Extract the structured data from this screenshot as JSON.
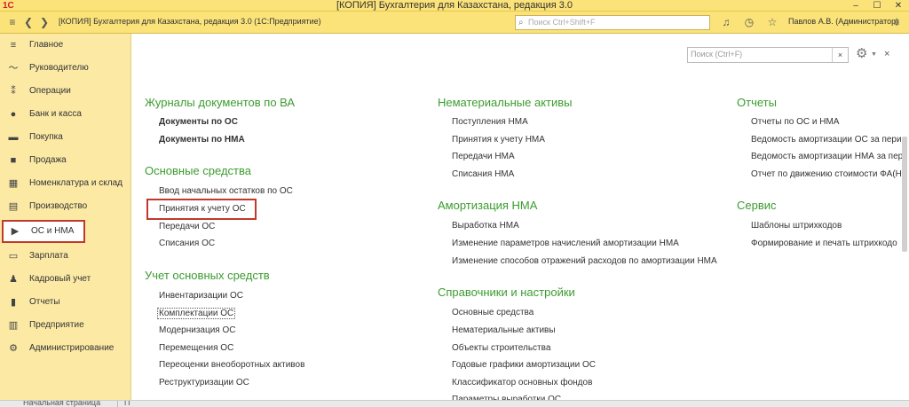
{
  "window": {
    "logo": "1С",
    "title": "[КОПИЯ] Бухгалтерия для Казахстана, редакция 3.0",
    "controls": [
      "–",
      "☐",
      "✕"
    ]
  },
  "toolbar": {
    "app_title": "[КОПИЯ] Бухгалтерия для Казахстана, редакция 3.0  (1С:Предприятие)",
    "search_placeholder": "Поиск Ctrl+Shift+F",
    "user": "Павлов А.В. (Администратор)"
  },
  "sidebar": {
    "items": [
      {
        "label": "Главное",
        "icon": "≡"
      },
      {
        "label": "Руководителю",
        "icon": "〜"
      },
      {
        "label": "Операции",
        "icon": "⁑"
      },
      {
        "label": "Банк и касса",
        "icon": "●"
      },
      {
        "label": "Покупка",
        "icon": "▬"
      },
      {
        "label": "Продажа",
        "icon": "■"
      },
      {
        "label": "Номенклатура и склад",
        "icon": "▦"
      },
      {
        "label": "Производство",
        "icon": "▤"
      },
      {
        "label": "ОС и НМА",
        "icon": "▶"
      },
      {
        "label": "Зарплата",
        "icon": "▭"
      },
      {
        "label": "Кадровый учет",
        "icon": "♟"
      },
      {
        "label": "Отчеты",
        "icon": "▮"
      },
      {
        "label": "Предприятие",
        "icon": "▥"
      },
      {
        "label": "Администрирование",
        "icon": "⚙"
      }
    ]
  },
  "bottombar": {
    "home": "Начальная страница",
    "next": "П"
  },
  "content": {
    "search_placeholder": "Поиск (Ctrl+F)",
    "clear": "×",
    "close": "×",
    "col1": {
      "sec1": "Журналы документов по ВА",
      "sec1_items": [
        "Документы по ОС",
        "Документы по НМА"
      ],
      "sec2": "Основные средства",
      "sec2_items": [
        "Ввод начальных остатков по ОС",
        "Принятия к учету ОС",
        "Передачи ОС",
        "Списания ОС"
      ],
      "sec3": "Учет основных средств",
      "sec3_items": [
        "Инвентаризации ОС",
        "Комплектации ОС",
        "Модернизация ОС",
        "Перемещения ОС",
        "Переоценки внеоборотных активов",
        "Реструктуризации ОС"
      ]
    },
    "col2": {
      "sec1": "Нематериальные активы",
      "sec1_items": [
        "Поступления НМА",
        "Принятия к учету НМА",
        "Передачи НМА",
        "Списания НМА"
      ],
      "sec2": "Амортизация НМА",
      "sec2_items": [
        "Выработка НМА",
        "Изменение параметров начислений амортизации НМА",
        "Изменение способов отражений расходов по амортизации НМА"
      ],
      "sec3": "Справочники и настройки",
      "sec3_items": [
        "Основные средства",
        "Нематериальные активы",
        "Объекты строительства",
        "Годовые графики амортизации ОС",
        "Классификатор основных фондов",
        "Параметры выработки ОС"
      ]
    },
    "col3": {
      "sec1": "Отчеты",
      "sec1_items": [
        "Отчеты по ОС и НМА",
        "Ведомость амортизации ОС за пери",
        "Ведомость амортизации НМА за пер",
        "Отчет по движению стоимости ФА(Н"
      ],
      "sec2": "Сервис",
      "sec2_items": [
        "Шаблоны штрихкодов",
        "Формирование и печать штрихкодо"
      ]
    }
  }
}
